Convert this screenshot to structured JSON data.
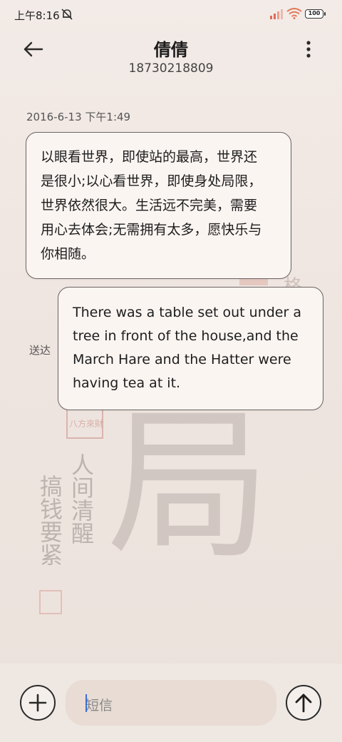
{
  "status_bar": {
    "time": "上午8:16",
    "battery": "100",
    "icons": [
      "mute-bell-icon",
      "signal-icon",
      "wifi-icon",
      "battery-icon"
    ]
  },
  "header": {
    "contact_name": "倩倩",
    "contact_number": "18730218809",
    "back_icon": "arrow-left-icon",
    "more_icon": "more-vertical-icon"
  },
  "conversation": {
    "timestamp": "2016-6-13 下午1:49",
    "incoming": {
      "lines": [
        "以眼看世界，即使站的最高，世界还",
        "是很小;以心看世界，即使身处局限，",
        "世界依然很大。生活远不完美，需要",
        "用心去体会;无需拥有太多，愿快乐与",
        "你相随。"
      ]
    },
    "outgoing": {
      "lines": [
        "There was a table set out under a",
        "tree in front of the house,and the",
        "March Hare and the Hatter were",
        "having tea at it."
      ],
      "status": "送达"
    }
  },
  "wallpaper": {
    "big_char": "局",
    "seal_text": "八方來財",
    "column_1": "人间清醒",
    "column_2": "搞钱要紧",
    "top_char": "格"
  },
  "composer": {
    "placeholder": "短信",
    "add_icon": "plus-icon",
    "send_icon": "arrow-up-icon"
  },
  "colors": {
    "background": "#f0e7e2",
    "bubble": "#fbf5f2",
    "bubble_border": "#6b6563",
    "cursor": "#3a6fd8"
  }
}
